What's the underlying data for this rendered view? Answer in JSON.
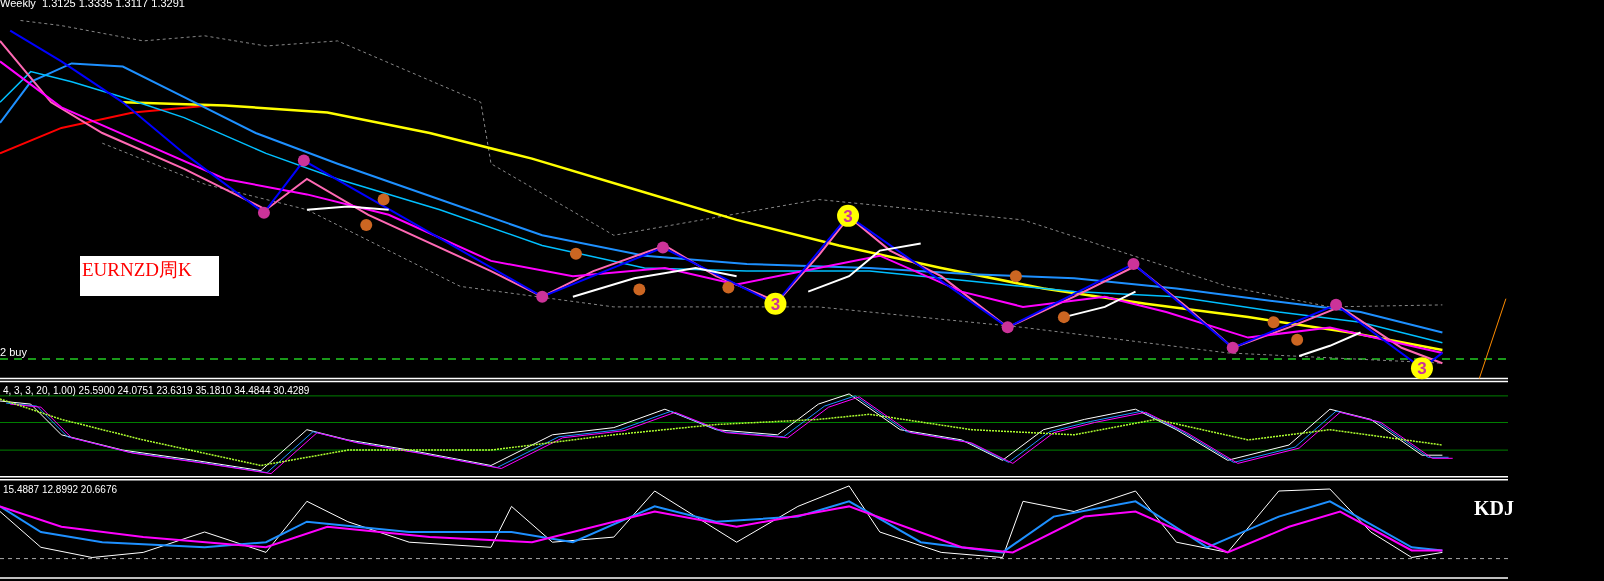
{
  "main_chart": {
    "header": "Weekly  1.3125 1.3335 1.3117 1.3291",
    "label": "EURNZD周K",
    "level_label": "2 buy",
    "wave_markers": [
      {
        "label": "3"
      },
      {
        "label": "3"
      },
      {
        "label": "3"
      }
    ]
  },
  "oscillator_panel": {
    "header": "4, 3, 3, 20, 1.00) 25.5900 24.0751 23.6319 35.1810 34.4844 30.4289"
  },
  "kdj_panel": {
    "header": "15.4887 12.8992 20.6676",
    "label": "KDJ"
  }
}
